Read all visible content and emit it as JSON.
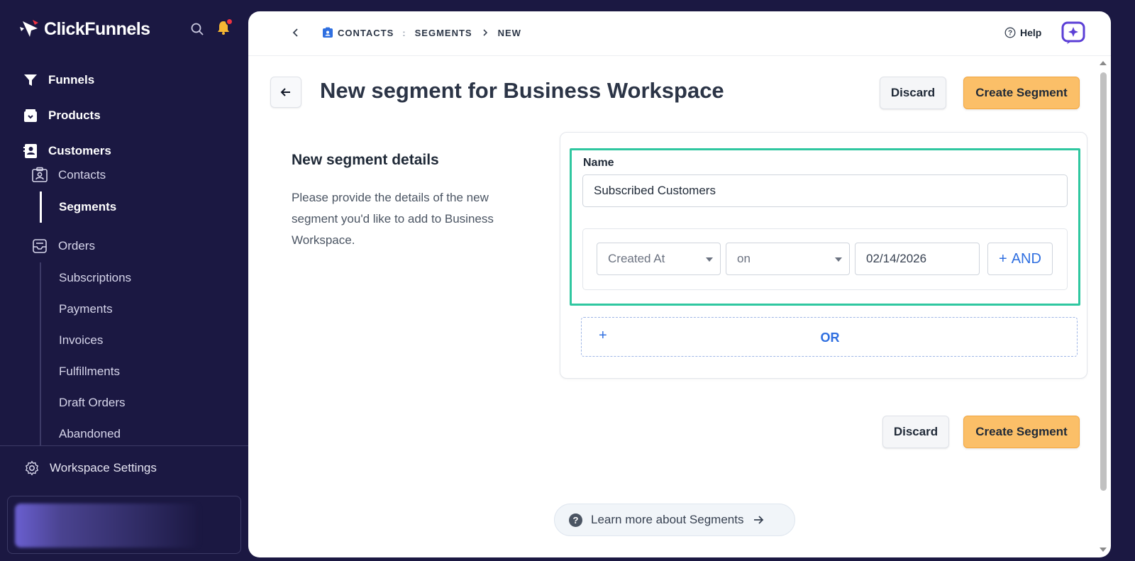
{
  "app": {
    "name": "ClickFunnels",
    "accent": "#1b1842",
    "highlight": "#2fc7a0",
    "link": "#2f6fe0",
    "primary": "#fbbf68"
  },
  "sidebar": {
    "icons": {
      "search": "search-icon",
      "bell": "bell-icon"
    },
    "top_items": [
      {
        "label": "Funnels",
        "icon": "funnel-icon"
      },
      {
        "label": "Products",
        "icon": "product-box-icon"
      },
      {
        "label": "Customers",
        "icon": "customers-icon"
      }
    ],
    "contacts": {
      "label": "Contacts",
      "icon": "contacts-icon",
      "children": [
        {
          "label": "Segments",
          "active": true
        }
      ]
    },
    "orders": {
      "label": "Orders",
      "icon": "orders-icon",
      "children": [
        {
          "label": "Subscriptions"
        },
        {
          "label": "Payments"
        },
        {
          "label": "Invoices"
        },
        {
          "label": "Fulfillments"
        },
        {
          "label": "Draft Orders"
        },
        {
          "label": "Abandoned"
        }
      ]
    },
    "workspace_settings": "Workspace Settings"
  },
  "topbar": {
    "breadcrumb": [
      "CONTACTS",
      "SEGMENTS",
      "NEW"
    ],
    "help": "Help"
  },
  "header": {
    "title": "New segment for Business Workspace",
    "discard": "Discard",
    "create": "Create Segment"
  },
  "details": {
    "title": "New segment details",
    "description": "Please provide the details of the new segment you'd like to add to Business Workspace."
  },
  "form": {
    "name_label": "Name",
    "name_value": "Subscribed Customers",
    "rule": {
      "field": "Created At",
      "operator": "on",
      "date": "02/14/2026",
      "and_label": "AND"
    },
    "or_label": "OR"
  },
  "footer": {
    "discard": "Discard",
    "create": "Create Segment",
    "learn_more": "Learn more about Segments"
  }
}
